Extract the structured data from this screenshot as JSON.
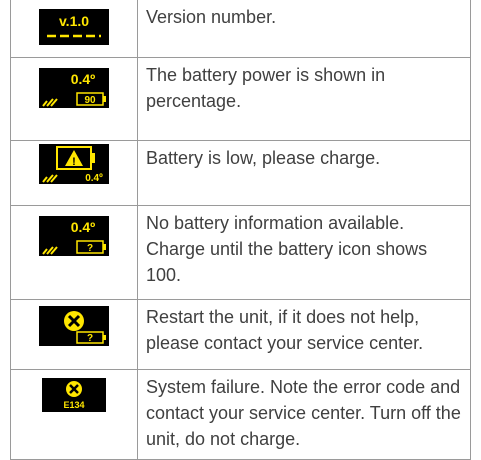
{
  "colors": {
    "display_bg": "#000000",
    "display_fg": "#ffe600",
    "border": "#9a9a9a",
    "text": "#404040"
  },
  "rows": [
    {
      "icon": {
        "name": "version-display-icon",
        "label": "v.1.0"
      },
      "text": "Version number."
    },
    {
      "icon": {
        "name": "battery-percentage-display-icon",
        "label": "0.4º",
        "value": "90"
      },
      "text": "The battery power is shown in percentage."
    },
    {
      "icon": {
        "name": "battery-low-display-icon",
        "label": "0.4º"
      },
      "text": "Battery is low, please charge."
    },
    {
      "icon": {
        "name": "battery-unknown-display-icon",
        "label": "0.4º",
        "value": "?"
      },
      "text": "No battery information available. Charge until the battery icon shows 100."
    },
    {
      "icon": {
        "name": "restart-error-display-icon",
        "value": "?"
      },
      "text": "Restart the unit, if it does not help, please contact your service center."
    },
    {
      "icon": {
        "name": "system-failure-display-icon",
        "label": "E134"
      },
      "text": "System failure. Note the error code and contact your service center. Turn off the unit, do not charge."
    }
  ]
}
